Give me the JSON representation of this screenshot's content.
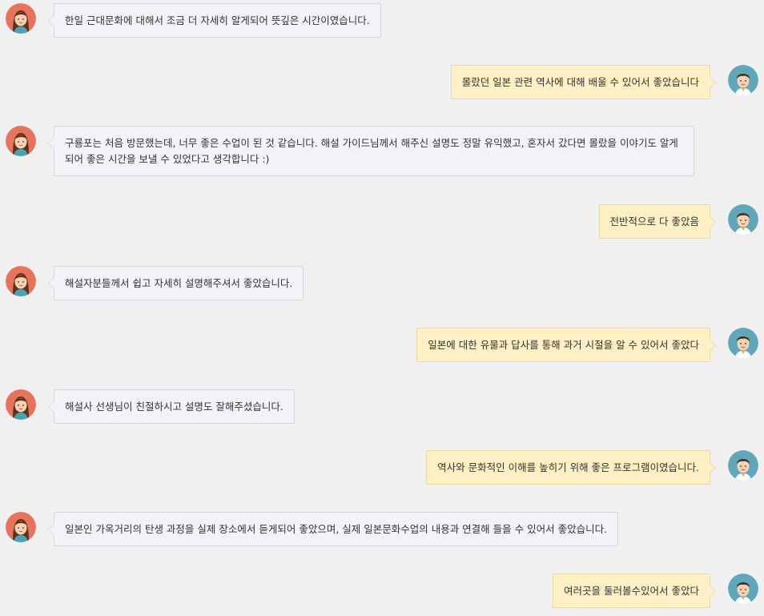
{
  "messages": [
    {
      "side": "left",
      "text": "한일 근대문화에 대해서 조금 더 자세히 알게되어 뜻깊은 시간이였습니다."
    },
    {
      "side": "right",
      "text": "몰랐던 일본 관련 역사에 대해 배울 수 있어서 좋았습니다"
    },
    {
      "side": "left",
      "text": "구룡포는 처음 방문했는데, 너무 좋은 수업이 된 것 같습니다. 해설 가이드님께서 해주신 설명도 정말 유익했고, 혼자서 갔다면 몰랐을 이야기도 알게 되어 좋은 시간을 보낼 수 있었다고 생각합니다 :)"
    },
    {
      "side": "right",
      "text": "전반적으로 다 좋았음"
    },
    {
      "side": "left",
      "text": "해설자분들께서 쉽고 자세히 설명해주셔서 좋았습니다."
    },
    {
      "side": "right",
      "text": "일본에 대한 유물과 답사를 통해 과거 시절을 알 수 있어서 좋았다"
    },
    {
      "side": "left",
      "text": "해설사 선생님이 친절하시고 설명도 잘해주셨습니다."
    },
    {
      "side": "right",
      "text": "역사와 문화적인 이해를 높히기 위해 좋은 프로그램이였습니다."
    },
    {
      "side": "left",
      "text": "일본인 가옥거리의 탄생 과정을 실제 장소에서 듣게되어 좋았으며, 실제 일본문화수업의 내용과 연결해 들을 수 있어서 좋았습니다."
    },
    {
      "side": "right",
      "text": "여러곳을 둘러볼수있어서 좋았다"
    }
  ]
}
